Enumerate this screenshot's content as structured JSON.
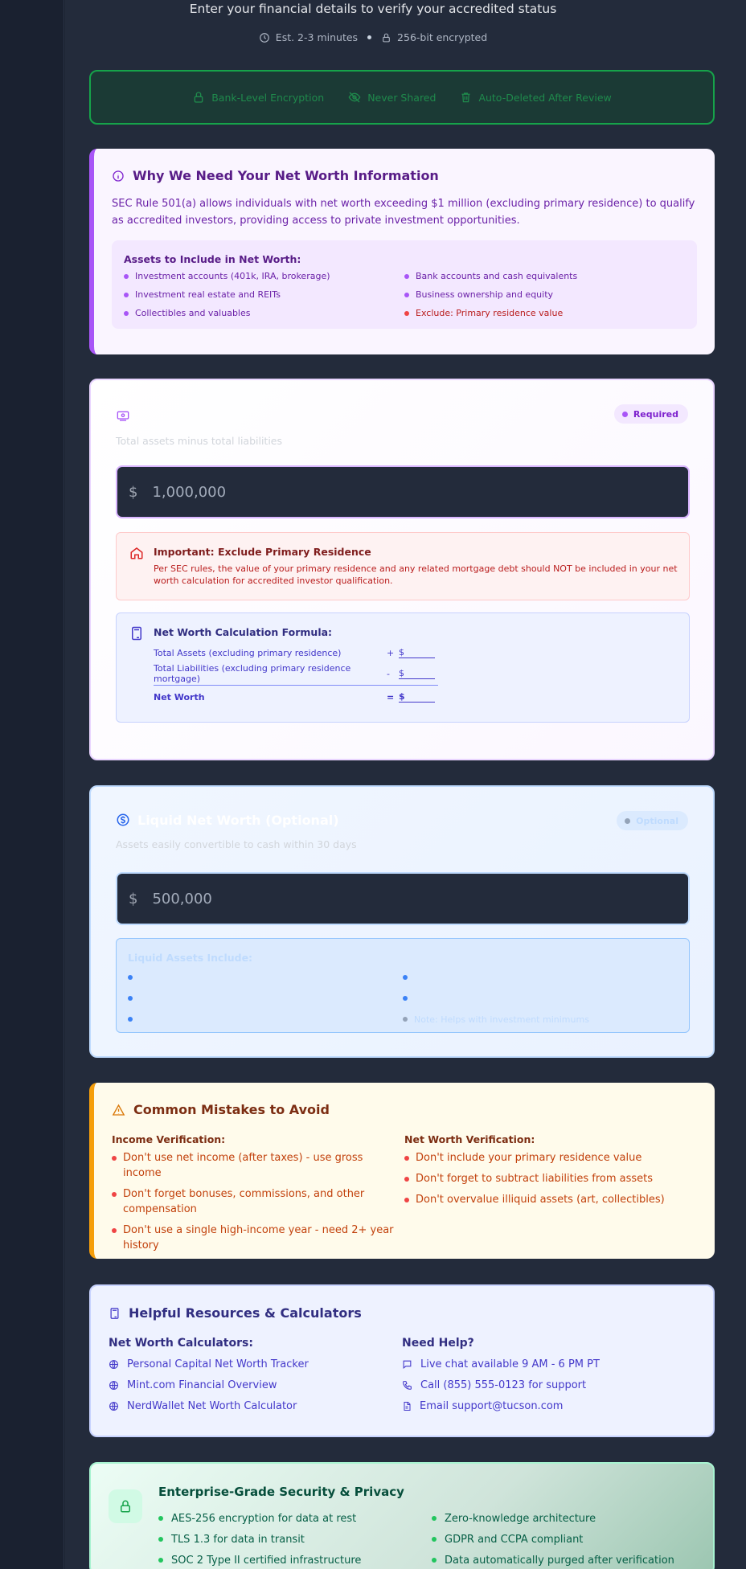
{
  "header": {
    "subtitle": "Enter your financial details to verify your accredited status",
    "time_estimate": "Est. 2-3 minutes",
    "encryption": "256-bit encrypted"
  },
  "trust": {
    "items": [
      "Bank-Level Encryption",
      "Never Shared",
      "Auto-Deleted After Review"
    ],
    "icons": [
      "lock-icon",
      "eye-off-icon",
      "trash-icon"
    ]
  },
  "why": {
    "title": "Why We Need Your Net Worth Information",
    "body": "SEC Rule 501(a) allows individuals with net worth exceeding $1 million (excluding primary residence) to qualify as accredited investors, providing access to private investment opportunities.",
    "assets_title": "Assets to Include in Net Worth:",
    "assets": [
      "Investment accounts (401k, IRA, brokerage)",
      "Bank accounts and cash equivalents",
      "Investment real estate and REITs",
      "Business ownership and equity",
      "Collectibles and valuables",
      "Exclude: Primary residence value"
    ]
  },
  "net_worth": {
    "badge": "Required",
    "description": "Total assets minus total liabilities",
    "currency": "$",
    "placeholder": "1,000,000",
    "warning_title": "Important: Exclude Primary Residence",
    "warning_body": "Per SEC rules, the value of your primary residence and any related mortgage debt should NOT be included in your net worth calculation for accredited investor qualification.",
    "formula_title": "Net Worth Calculation Formula:",
    "formula_rows": [
      {
        "label": "Total Assets (excluding primary residence)",
        "op": "+",
        "value": "$"
      },
      {
        "label": "Total Liabilities (excluding primary residence mortgage)",
        "op": "-",
        "value": "$"
      },
      {
        "label": "Net Worth",
        "op": "=",
        "value": "$"
      }
    ]
  },
  "liquid": {
    "title": "Liquid Net Worth (Optional)",
    "badge": "Optional",
    "description": "Assets easily convertible to cash within 30 days",
    "currency": "$",
    "placeholder": "500,000",
    "box_title": "Liquid Assets Include:",
    "note": "Note: Helps with investment minimums"
  },
  "mistakes": {
    "title": "Common Mistakes to Avoid",
    "income_title": "Income Verification:",
    "income": [
      "Don't use net income (after taxes) - use gross income",
      "Don't forget bonuses, commissions, and other compensation",
      "Don't use a single high-income year - need 2+ year history"
    ],
    "networth_title": "Net Worth Verification:",
    "networth": [
      "Don't include your primary residence value",
      "Don't forget to subtract liabilities from assets",
      "Don't overvalue illiquid assets (art, collectibles)"
    ]
  },
  "resources": {
    "title": "Helpful Resources & Calculators",
    "calc_title": "Net Worth Calculators:",
    "calcs": [
      "Personal Capital Net Worth Tracker",
      "Mint.com Financial Overview",
      "NerdWallet Net Worth Calculator"
    ],
    "help_title": "Need Help?",
    "help": [
      "Live chat available 9 AM - 6 PM PT",
      "Call (855) 555-0123 for support",
      "Email support@tucson.com"
    ]
  },
  "security": {
    "title": "Enterprise-Grade Security & Privacy",
    "items": [
      "AES-256 encryption for data at rest",
      "Zero-knowledge architecture",
      "TLS 1.3 for data in transit",
      "GDPR and CCPA compliant",
      "SOC 2 Type II certified infrastructure",
      "Data automatically purged after verification"
    ]
  }
}
